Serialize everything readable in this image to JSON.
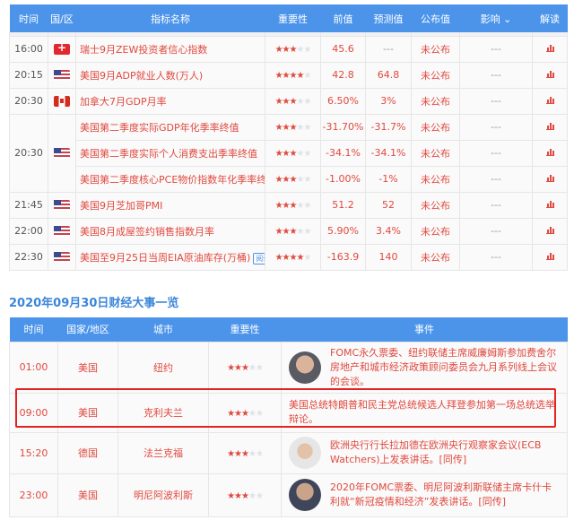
{
  "calendar": {
    "headers": [
      "时间",
      "国/区",
      "指标名称",
      "重要性",
      "前值",
      "预测值",
      "公布值",
      "影响",
      "解读"
    ],
    "rows": [
      {
        "time": "16:00",
        "flag": "ch",
        "name": "瑞士9月ZEW投资者信心指数",
        "stars": 3,
        "prev": "45.6",
        "forecast": "---",
        "actual": "未公布",
        "impact": "---"
      },
      {
        "time": "20:15",
        "flag": "us",
        "name": "美国9月ADP就业人数(万人)",
        "stars": 4,
        "prev": "42.8",
        "forecast": "64.8",
        "actual": "未公布",
        "impact": "---"
      },
      {
        "time": "20:30",
        "flag": "ca",
        "name": "加拿大7月GDP月率",
        "stars": 3,
        "prev": "6.50%",
        "forecast": "3%",
        "actual": "未公布",
        "impact": "---"
      },
      {
        "time": "20:30",
        "flag": "us",
        "name": "美国第二季度实际GDP年化季率终值",
        "stars": 3,
        "prev": "-31.70%",
        "forecast": "-31.7%",
        "actual": "未公布",
        "impact": "---",
        "group_start": 3
      },
      {
        "time": "",
        "flag": "",
        "name": "美国第二季度实际个人消费支出季率终值",
        "stars": 3,
        "prev": "-34.1%",
        "forecast": "-34.1%",
        "actual": "未公布",
        "impact": "---",
        "grouped": true
      },
      {
        "time": "",
        "flag": "",
        "name": "美国第二季度核心PCE物价指数年化季率终值",
        "stars": 3,
        "prev": "-1.00%",
        "forecast": "-1%",
        "actual": "未公布",
        "impact": "---",
        "grouped": true
      },
      {
        "time": "21:45",
        "flag": "us",
        "name": "美国9月芝加哥PMI",
        "stars": 3,
        "prev": "51.2",
        "forecast": "52",
        "actual": "未公布",
        "impact": "---"
      },
      {
        "time": "22:00",
        "flag": "us",
        "name": "美国8月成屋签约销售指数月率",
        "stars": 3,
        "prev": "5.90%",
        "forecast": "3.4%",
        "actual": "未公布",
        "impact": "---"
      },
      {
        "time": "22:30",
        "flag": "us",
        "name": "美国至9月25日当周EIA原油库存(万桶)",
        "badge": "阅读",
        "stars": 4,
        "prev": "-163.9",
        "forecast": "140",
        "actual": "未公布",
        "impact": "---"
      }
    ]
  },
  "events": {
    "title": "2020年09月30日财经大事一览",
    "headers": [
      "时间",
      "国家/地区",
      "城市",
      "重要性",
      "事件"
    ],
    "rows": [
      {
        "time": "01:00",
        "country": "美国",
        "city": "纽约",
        "stars": 3,
        "avatar": "av1",
        "event": "FOMC永久票委、纽约联储主席威廉姆斯参加费舍尔房地产和城市经济政策顾问委员会九月系列线上会议的会谈。"
      },
      {
        "time": "09:00",
        "country": "美国",
        "city": "克利夫兰",
        "stars": 3,
        "avatar": "",
        "event": "美国总统特朗普和民主党总统候选人拜登参加第一场总统选举辩论。"
      },
      {
        "time": "15:20",
        "country": "德国",
        "city": "法兰克福",
        "stars": 3,
        "avatar": "av2",
        "event": "欧洲央行行长拉加德在欧洲央行观察家会议(ECB Watchers)上发表讲话。[同传]"
      },
      {
        "time": "23:00",
        "country": "美国",
        "city": "明尼阿波利斯",
        "stars": 3,
        "avatar": "av3",
        "event": "2020年FOMC票委、明尼阿波利斯联储主席卡什卡利就“新冠疫情和经济”发表讲话。[同传]"
      }
    ]
  }
}
